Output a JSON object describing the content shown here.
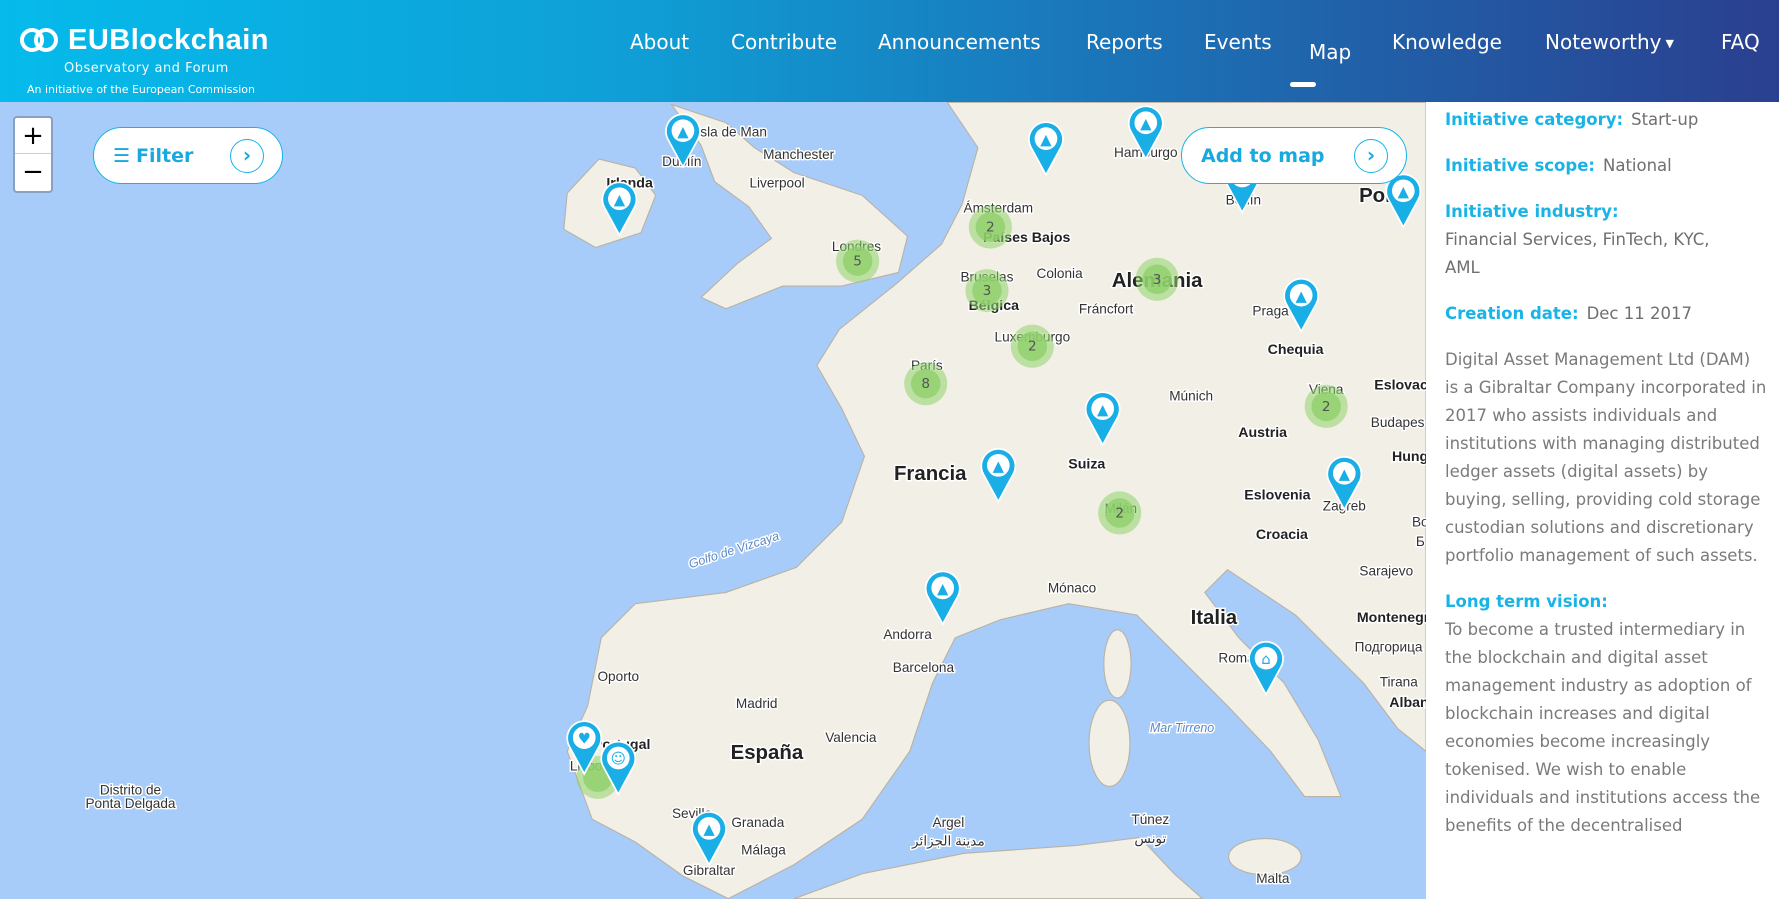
{
  "header": {
    "logo": {
      "title": "EUBlockchain",
      "subtitle": "Observatory and Forum",
      "tagline": "An initiative of the European Commission"
    },
    "nav": [
      {
        "label": "About"
      },
      {
        "label": "Contribute"
      },
      {
        "label": "Announcements"
      },
      {
        "label": "Reports"
      },
      {
        "label": "Events"
      },
      {
        "label": "Map",
        "active": true
      },
      {
        "label": "Knowledge"
      },
      {
        "label": "Noteworthy",
        "dropdown": true
      },
      {
        "label": "FAQ"
      }
    ],
    "colors": {
      "gradient_start": "#05bbeb",
      "gradient_end": "#2a3f8f"
    }
  },
  "map": {
    "zoom_in": "+",
    "zoom_out": "−",
    "filter_button": {
      "label": "Filter",
      "icon": "list-icon"
    },
    "add_button": {
      "label": "Add to map"
    },
    "labels": [
      "Isla de Man",
      "Dublín",
      "Irlanda",
      "Manchester",
      "Liverpool",
      "Londres",
      "Ámsterdam",
      "Países Bajos",
      "Hamburgo",
      "Berlín",
      "Pol",
      "Bruselas",
      "Bélgica",
      "Colonia",
      "Alemania",
      "Fráncfort",
      "Praga",
      "Chequia",
      "Luxemburgo",
      "París",
      "Múnich",
      "Eslovac",
      "Austria",
      "Budapes",
      "Francia",
      "Suiza",
      "Eslovenia",
      "Zagreb",
      "Hung",
      "Croacia",
      "Golfo de Vizcaya",
      "Milán",
      "Mónaco",
      "Sarajevo",
      "Montenegr",
      "Подгорица",
      "Andorra",
      "Italia",
      "Barcelona",
      "Roma",
      "Oporto",
      "Tirana",
      "Alban",
      "Madrid",
      "España",
      "Valencia",
      "Portugal",
      "Mar Tirreno",
      "Lisboa",
      "Distrito de",
      "Ponta Delgada",
      "Sevilla",
      "Granada",
      "Argel",
      "مدينة الجزائر",
      "Túnez",
      "تونس",
      "Málaga",
      "Gibraltar",
      "Malta",
      "Viena",
      "Bo",
      "Б"
    ],
    "clusters": [
      {
        "count": "5"
      },
      {
        "count": "2"
      },
      {
        "count": "3"
      },
      {
        "count": "3"
      },
      {
        "count": "2"
      },
      {
        "count": "8"
      },
      {
        "count": "2"
      },
      {
        "count": "2"
      },
      {
        "count": ""
      }
    ],
    "markers": [
      {
        "icon": "rocket-icon"
      },
      {
        "icon": "rocket-icon"
      },
      {
        "icon": "rocket-icon"
      },
      {
        "icon": "rocket-icon"
      },
      {
        "icon": "rocket-icon"
      },
      {
        "icon": "rocket-icon"
      },
      {
        "icon": "rocket-icon"
      },
      {
        "icon": "rocket-icon"
      },
      {
        "icon": "rocket-icon"
      },
      {
        "icon": "rocket-icon"
      },
      {
        "icon": "rocket-icon"
      },
      {
        "icon": "bank-icon"
      },
      {
        "icon": "handshake-icon"
      },
      {
        "icon": "people-icon"
      },
      {
        "icon": "rocket-icon"
      }
    ],
    "colors": {
      "sea": "#a8ccf9",
      "land": "#f2efe6",
      "marker": "#1aaee6",
      "cluster": "#8fd16a"
    }
  },
  "panel": {
    "category": {
      "label": "Initiative category:",
      "value": "Start-up"
    },
    "scope": {
      "label": "Initiative scope:",
      "value": "National"
    },
    "industry": {
      "label": "Initiative industry:",
      "value": "Financial Services, FinTech, KYC, AML"
    },
    "creation": {
      "label": "Creation date:",
      "value": "Dec 11 2017"
    },
    "description": "Digital Asset Management Ltd (DAM) is a Gibraltar Company incorporated in 2017 who assists individuals and institutions with managing distributed ledger assets (digital assets) by buying, selling, providing cold storage custodian solutions and discretionary portfolio management of such assets.",
    "vision": {
      "label": "Long term vision:",
      "value": "To become a trusted intermediary in the blockchain and digital asset management industry as adoption of blockchain increases and digital economies become increasingly tokenised. We wish to enable individuals and institutions access the benefits of the decentralised"
    }
  }
}
